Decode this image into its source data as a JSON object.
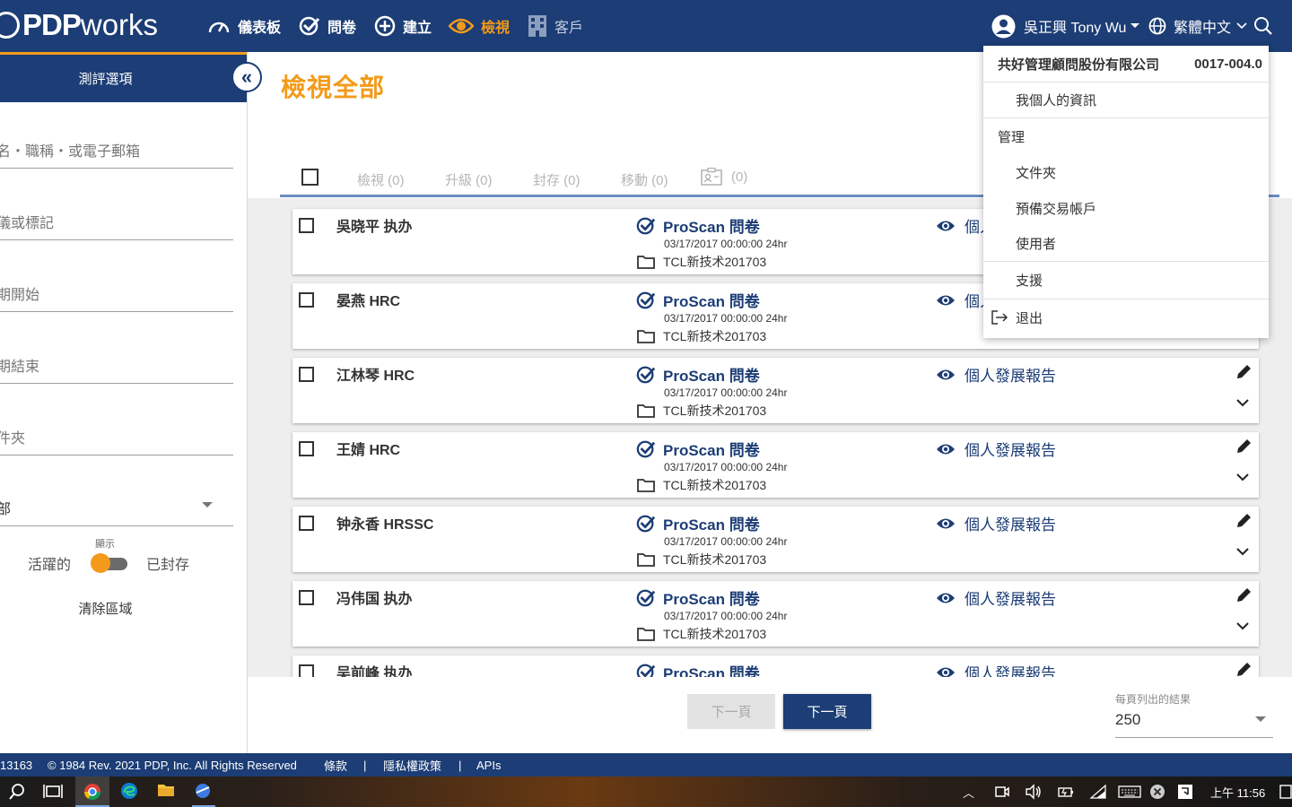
{
  "nav": {
    "logo_pdp": "PDP",
    "logo_works": "works",
    "items": [
      {
        "label": "儀表板",
        "icon": "gauge-icon"
      },
      {
        "label": "問卷",
        "icon": "check-circle-icon"
      },
      {
        "label": "建立",
        "icon": "plus-circle-icon"
      },
      {
        "label": "檢視",
        "icon": "eye-icon"
      },
      {
        "label": "客戶",
        "icon": "building-icon"
      }
    ],
    "user_name": "吳正興 Tony Wu",
    "language": "繁體中文"
  },
  "sidebar": {
    "header": "測評選項",
    "fields": [
      {
        "placeholder": "名・職稱・或電子郵箱"
      },
      {
        "placeholder": "儀或標記"
      },
      {
        "placeholder": "期開始"
      },
      {
        "placeholder": "期結束"
      },
      {
        "placeholder": "件夾"
      },
      {
        "value": "部"
      }
    ],
    "toggle": {
      "caption": "顯示",
      "left_label": "活躍的",
      "right_label": "已封存"
    },
    "clear_label": "清除區域"
  },
  "main": {
    "title": "檢視全部",
    "toolbar": [
      {
        "label": "檢視 (0)"
      },
      {
        "label": "升級 (0)"
      },
      {
        "label": "封存 (0)"
      },
      {
        "label": "移動 (0)"
      },
      {
        "label": "(0)"
      }
    ],
    "rows": [
      {
        "name": "吳晓平 执办",
        "survey": "ProScan 問卷",
        "date": "03/17/2017 00:00:00 24hr",
        "folder": "TCL新技术201703",
        "report": "個人發展報告"
      },
      {
        "name": "晏燕 HRC",
        "survey": "ProScan 問卷",
        "date": "03/17/2017 00:00:00 24hr",
        "folder": "TCL新技术201703",
        "report": "個人發展報告"
      },
      {
        "name": "江林琴 HRC",
        "survey": "ProScan 問卷",
        "date": "03/17/2017 00:00:00 24hr",
        "folder": "TCL新技术201703",
        "report": "個人發展報告"
      },
      {
        "name": "王婧 HRC",
        "survey": "ProScan 問卷",
        "date": "03/17/2017 00:00:00 24hr",
        "folder": "TCL新技术201703",
        "report": "個人發展報告"
      },
      {
        "name": "钟永香 HRSSC",
        "survey": "ProScan 問卷",
        "date": "03/17/2017 00:00:00 24hr",
        "folder": "TCL新技术201703",
        "report": "個人發展報告"
      },
      {
        "name": "冯伟国 执办",
        "survey": "ProScan 問卷",
        "date": "03/17/2017 00:00:00 24hr",
        "folder": "TCL新技术201703",
        "report": "個人發展報告"
      },
      {
        "name": "吴前峰 执办",
        "survey": "ProScan 問卷",
        "date": "",
        "folder": "",
        "report": "個人發展報告"
      }
    ]
  },
  "pager": {
    "prev_label": "下一頁",
    "next_label": "下一頁",
    "per_page_label": "每頁列出的結果",
    "per_page_value": "250"
  },
  "footer": {
    "id": "13163",
    "copyright": "© 1984 Rev. 2021 PDP, Inc. All Rights Reserved",
    "terms": "條款",
    "sep": "|",
    "privacy": "隱私權政策",
    "apis": "APIs"
  },
  "menu": {
    "company": "共好管理顧問股份有限公司",
    "code": "0017-004.0",
    "profile": "我個人的資訊",
    "manage": "管理",
    "folders": "文件夾",
    "reserve": "預備交易帳戶",
    "users": "使用者",
    "support": "支援",
    "logout": "退出"
  },
  "taskbar": {
    "time": "上午 11:56"
  },
  "colors": {
    "navy": "#1c3d75",
    "orange": "#f39a1b"
  }
}
